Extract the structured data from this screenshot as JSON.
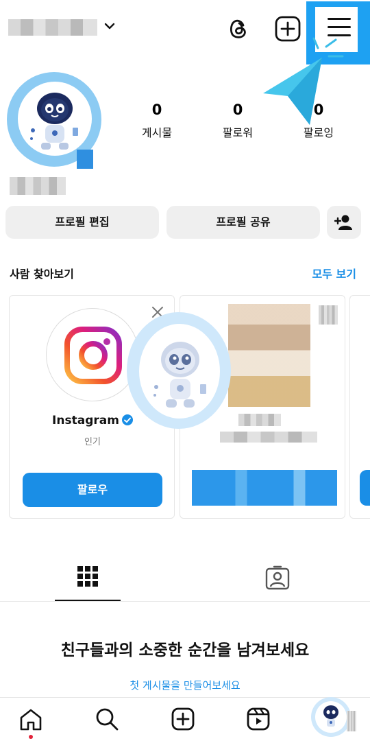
{
  "profile": {
    "stats": [
      {
        "value": "0",
        "label": "게시물"
      },
      {
        "value": "0",
        "label": "팔로워"
      },
      {
        "value": "0",
        "label": "팔로잉"
      }
    ],
    "edit_profile_label": "프로필 편집",
    "share_profile_label": "프로필 공유"
  },
  "discover": {
    "title": "사람 찾아보기",
    "see_all_label": "모두 보기",
    "cards": [
      {
        "name": "Instagram",
        "subtitle": "인기",
        "follow_label": "팔로우"
      }
    ]
  },
  "content_tabs": {
    "empty_title": "친구들과의 소중한 순간을 남겨보세요",
    "empty_cta": "첫 게시물을 만들어보세요"
  },
  "icons": {
    "top": [
      "chevron-down-icon",
      "threads-icon",
      "create-plus-icon",
      "menu-icon"
    ],
    "bottom": [
      "home-icon",
      "search-icon",
      "create-icon",
      "reels-icon"
    ]
  },
  "colors": {
    "accent": "#1a8ee6",
    "highlight": "#1ea1f2",
    "pill_bg": "#efefef"
  }
}
